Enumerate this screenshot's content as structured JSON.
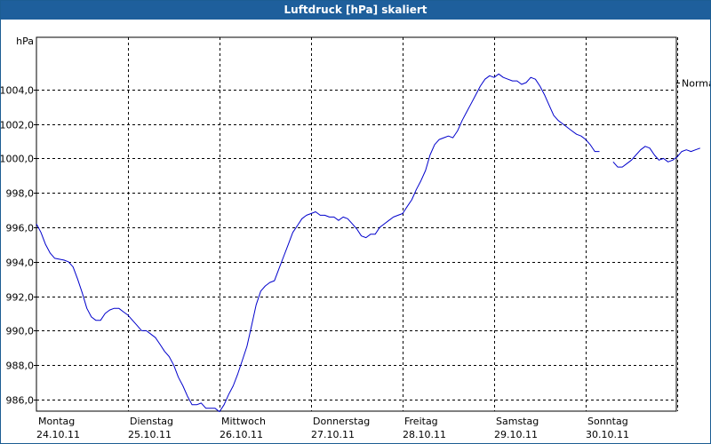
{
  "window": {
    "title": "Luftdruck [hPa] skaliert"
  },
  "chart_data": {
    "type": "line",
    "title": "Luftdruck [hPa] skaliert",
    "ylabel": "hPa",
    "ylim": [
      984.0,
      1006.0
    ],
    "xlim": [
      0,
      7
    ],
    "grid": true,
    "yticks": [
      "986,0",
      "988,0",
      "990,0",
      "992,0",
      "994,0",
      "996,0",
      "998,0",
      "1000,0",
      "1002,0",
      "1004,0"
    ],
    "ytick_values": [
      986,
      988,
      990,
      992,
      994,
      996,
      998,
      1000,
      1002,
      1004
    ],
    "xticks": [
      {
        "day": "Montag",
        "date": "24.10.11"
      },
      {
        "day": "Dienstag",
        "date": "25.10.11"
      },
      {
        "day": "Mittwoch",
        "date": "26.10.11"
      },
      {
        "day": "Donnerstag",
        "date": "27.10.11"
      },
      {
        "day": "Freitag",
        "date": "28.10.11"
      },
      {
        "day": "Samstag",
        "date": "29.10.11"
      },
      {
        "day": "Sonntag",
        "date": "30.10.11"
      }
    ],
    "reference": {
      "name": "Normal",
      "value": 1004.4
    },
    "series": [
      {
        "color": "#0000cc",
        "segments": [
          [
            [
              0.0,
              996.2
            ],
            [
              0.05,
              995.7
            ],
            [
              0.1,
              995.0
            ],
            [
              0.15,
              994.5
            ],
            [
              0.2,
              994.2
            ],
            [
              0.3,
              994.1
            ],
            [
              0.35,
              994.0
            ],
            [
              0.4,
              993.7
            ],
            [
              0.45,
              993.0
            ],
            [
              0.5,
              992.2
            ],
            [
              0.55,
              991.3
            ],
            [
              0.6,
              990.8
            ],
            [
              0.65,
              990.6
            ],
            [
              0.7,
              990.6
            ],
            [
              0.75,
              991.0
            ],
            [
              0.8,
              991.2
            ],
            [
              0.85,
              991.3
            ],
            [
              0.9,
              991.3
            ],
            [
              0.95,
              991.1
            ],
            [
              1.0,
              990.9
            ],
            [
              1.05,
              990.6
            ],
            [
              1.1,
              990.3
            ],
            [
              1.15,
              990.0
            ],
            [
              1.2,
              990.0
            ],
            [
              1.25,
              989.8
            ],
            [
              1.3,
              989.6
            ],
            [
              1.35,
              989.2
            ],
            [
              1.4,
              988.8
            ],
            [
              1.45,
              988.5
            ],
            [
              1.5,
              988.0
            ],
            [
              1.55,
              987.3
            ],
            [
              1.6,
              986.8
            ],
            [
              1.65,
              986.2
            ],
            [
              1.7,
              985.7
            ],
            [
              1.75,
              985.7
            ],
            [
              1.8,
              985.8
            ],
            [
              1.85,
              985.5
            ],
            [
              1.9,
              985.5
            ],
            [
              1.95,
              985.5
            ],
            [
              2.0,
              985.3
            ],
            [
              2.05,
              985.7
            ],
            [
              2.1,
              986.3
            ],
            [
              2.15,
              986.8
            ],
            [
              2.2,
              987.5
            ],
            [
              2.25,
              988.3
            ],
            [
              2.3,
              989.1
            ],
            [
              2.35,
              990.3
            ],
            [
              2.4,
              991.5
            ],
            [
              2.45,
              992.3
            ],
            [
              2.5,
              992.6
            ],
            [
              2.55,
              992.8
            ],
            [
              2.6,
              992.9
            ],
            [
              2.65,
              993.6
            ],
            [
              2.7,
              994.3
            ],
            [
              2.75,
              995.0
            ],
            [
              2.8,
              995.7
            ],
            [
              2.85,
              996.1
            ],
            [
              2.9,
              996.5
            ],
            [
              2.95,
              996.7
            ],
            [
              3.0,
              996.8
            ],
            [
              3.05,
              996.9
            ],
            [
              3.1,
              996.7
            ],
            [
              3.15,
              996.7
            ],
            [
              3.2,
              996.6
            ],
            [
              3.25,
              996.6
            ],
            [
              3.3,
              996.4
            ],
            [
              3.35,
              996.6
            ],
            [
              3.4,
              996.5
            ],
            [
              3.45,
              996.2
            ],
            [
              3.5,
              995.9
            ],
            [
              3.55,
              995.5
            ],
            [
              3.6,
              995.4
            ],
            [
              3.65,
              995.6
            ],
            [
              3.7,
              995.6
            ],
            [
              3.75,
              996.0
            ],
            [
              3.8,
              996.2
            ],
            [
              3.85,
              996.4
            ],
            [
              3.9,
              996.6
            ],
            [
              3.95,
              996.7
            ],
            [
              4.0,
              996.8
            ],
            [
              4.05,
              997.2
            ],
            [
              4.1,
              997.6
            ],
            [
              4.15,
              998.2
            ],
            [
              4.2,
              998.7
            ],
            [
              4.25,
              999.3
            ],
            [
              4.3,
              1000.2
            ],
            [
              4.35,
              1000.8
            ],
            [
              4.4,
              1001.1
            ],
            [
              4.45,
              1001.2
            ],
            [
              4.5,
              1001.3
            ],
            [
              4.55,
              1001.2
            ],
            [
              4.6,
              1001.6
            ],
            [
              4.65,
              1002.2
            ],
            [
              4.7,
              1002.7
            ],
            [
              4.75,
              1003.2
            ],
            [
              4.8,
              1003.7
            ],
            [
              4.85,
              1004.2
            ],
            [
              4.9,
              1004.6
            ],
            [
              4.95,
              1004.8
            ],
            [
              5.0,
              1004.7
            ],
            [
              5.05,
              1004.9
            ],
            [
              5.1,
              1004.7
            ],
            [
              5.15,
              1004.6
            ],
            [
              5.2,
              1004.5
            ],
            [
              5.25,
              1004.5
            ],
            [
              5.3,
              1004.3
            ],
            [
              5.35,
              1004.4
            ],
            [
              5.4,
              1004.7
            ],
            [
              5.45,
              1004.6
            ],
            [
              5.5,
              1004.2
            ],
            [
              5.55,
              1003.7
            ],
            [
              5.6,
              1003.1
            ],
            [
              5.65,
              1002.5
            ],
            [
              5.7,
              1002.2
            ],
            [
              5.75,
              1002.0
            ],
            [
              5.8,
              1001.8
            ],
            [
              5.85,
              1001.6
            ],
            [
              5.9,
              1001.4
            ],
            [
              5.95,
              1001.3
            ],
            [
              6.0,
              1001.1
            ],
            [
              6.05,
              1000.8
            ],
            [
              6.1,
              1000.4
            ],
            [
              6.15,
              1000.4
            ]
          ],
          [
            [
              6.3,
              999.8
            ],
            [
              6.35,
              999.5
            ],
            [
              6.4,
              999.5
            ],
            [
              6.45,
              999.7
            ],
            [
              6.5,
              999.9
            ],
            [
              6.55,
              1000.2
            ],
            [
              6.6,
              1000.5
            ],
            [
              6.65,
              1000.7
            ],
            [
              6.7,
              1000.6
            ],
            [
              6.75,
              1000.2
            ],
            [
              6.8,
              999.9
            ],
            [
              6.85,
              1000.0
            ],
            [
              6.9,
              999.8
            ],
            [
              6.95,
              999.9
            ],
            [
              7.0,
              1000.1
            ],
            [
              7.05,
              1000.4
            ],
            [
              7.1,
              1000.5
            ],
            [
              7.15,
              1000.4
            ],
            [
              7.2,
              1000.5
            ],
            [
              7.25,
              1000.6
            ]
          ]
        ]
      }
    ]
  }
}
